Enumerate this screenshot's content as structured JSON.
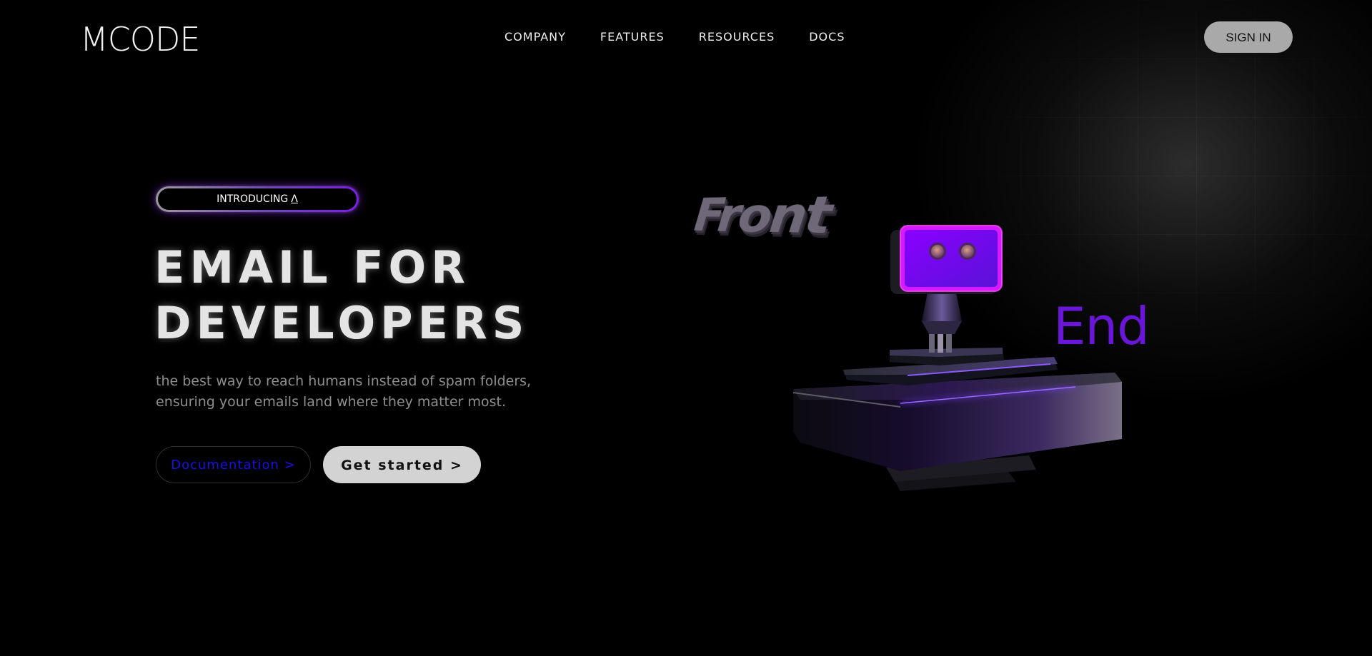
{
  "header": {
    "logo": "MCODE",
    "nav": [
      "COMPANY",
      "FEATURES",
      "RESOURCES",
      "DOCS"
    ],
    "signin_label": "SIGN IN"
  },
  "hero": {
    "badge_text": "INTRODUCING",
    "badge_mark": "Λ",
    "headline_line1": "EMAIL FOR",
    "headline_line2": "DEVELOPERS",
    "subtext_line1": "the best way to reach humans instead of spam folders,",
    "subtext_line2": "ensuring your emails land where they matter most.",
    "doc_button": "Documentation >",
    "start_button": "Get started >"
  },
  "illustration": {
    "word_front": "Front",
    "word_end": "End",
    "accent_color": "#7a1ee8",
    "robot_screen_color": "#a000ff"
  }
}
